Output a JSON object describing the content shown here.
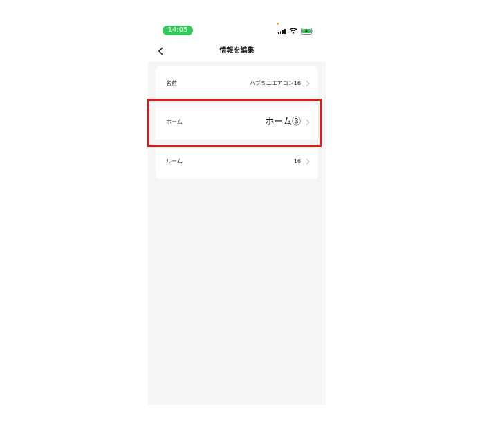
{
  "status_bar": {
    "time": "14:05",
    "icons": [
      "signal-icon",
      "wifi-icon",
      "battery-charging-icon"
    ],
    "time_pill_color": "#34c759"
  },
  "nav": {
    "title": "情報を編集",
    "back_icon": "chevron-left-icon"
  },
  "rows": [
    {
      "label": "名前",
      "value": "ハブミニエアコン16"
    },
    {
      "label": "ホーム",
      "value": "ホーム③"
    },
    {
      "label": "ルーム",
      "value": "16"
    }
  ],
  "highlight_color": "#e01b1b"
}
